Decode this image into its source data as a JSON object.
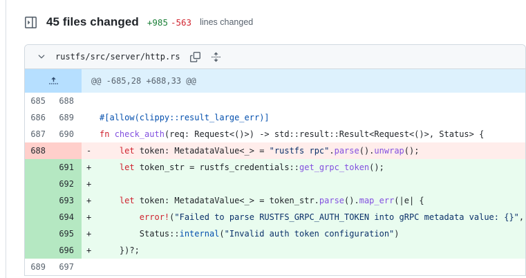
{
  "header": {
    "title": "45 files changed",
    "additions": "+985",
    "deletions": "-563",
    "suffix": "lines changed"
  },
  "file": {
    "path": "rustfs/src/server/http.rs",
    "hunk_header": "@@ -685,28 +688,33 @@"
  },
  "icons": {
    "sidebar_toggle": "sidebar-expand-icon",
    "collapse_chevron": "chevron-down-icon",
    "copy_path": "copy-icon",
    "unfold_file": "unfold-vertical-icon",
    "expand_hunk": "expand-up-icon"
  },
  "ui_colors": {
    "accent_green": "#1a7f37",
    "accent_red": "#d1242f",
    "border": "#d1d9e0",
    "file_header_bg": "#f6f8fa",
    "hunk_bg": "#ddf1fd",
    "hunk_gutter_bg": "#b6dfff",
    "hunk_text": "#59636e",
    "del_bg": "#ffedeb",
    "del_gutter_bg": "#ffcfcb",
    "add_bg": "#e9fcef",
    "add_gutter_bg": "#b5e8c2"
  },
  "syntax_colors": {
    "d": "#1f2328",
    "kw": "#cf222e",
    "fn": "#8250df",
    "call": "#0550ae",
    "attr": "#0550ae",
    "str": "#0a3069"
  },
  "diff": {
    "rows": [
      {
        "old": "685",
        "new": "688",
        "type": "context",
        "marker": " ",
        "code": []
      },
      {
        "old": "686",
        "new": "689",
        "type": "context",
        "marker": " ",
        "code": [
          {
            "t": "#[allow(clippy::result_large_err)]",
            "c": "attr"
          }
        ]
      },
      {
        "old": "687",
        "new": "690",
        "type": "context",
        "marker": " ",
        "code": [
          {
            "t": "fn",
            "c": "kw"
          },
          {
            "t": " ",
            "c": "d"
          },
          {
            "t": "check_auth",
            "c": "fn"
          },
          {
            "t": "(req: Request<()>) -> std::result::Result<Request<()>, Status> {",
            "c": "d"
          }
        ]
      },
      {
        "old": "688",
        "new": "",
        "type": "del",
        "marker": "-",
        "code": [
          {
            "t": "    ",
            "c": "d"
          },
          {
            "t": "let",
            "c": "kw"
          },
          {
            "t": " token: MetadataValue<_> = ",
            "c": "d"
          },
          {
            "t": "\"rustfs rpc\"",
            "c": "str"
          },
          {
            "t": ".",
            "c": "d"
          },
          {
            "t": "parse",
            "c": "fn"
          },
          {
            "t": "().",
            "c": "d"
          },
          {
            "t": "unwrap",
            "c": "fn"
          },
          {
            "t": "();",
            "c": "d"
          }
        ]
      },
      {
        "old": "",
        "new": "691",
        "type": "add",
        "marker": "+",
        "code": [
          {
            "t": "    ",
            "c": "d"
          },
          {
            "t": "let",
            "c": "kw"
          },
          {
            "t": " token_str = rustfs_credentials::",
            "c": "d"
          },
          {
            "t": "get_grpc_token",
            "c": "fn"
          },
          {
            "t": "();",
            "c": "d"
          }
        ]
      },
      {
        "old": "",
        "new": "692",
        "type": "add",
        "marker": "+",
        "code": []
      },
      {
        "old": "",
        "new": "693",
        "type": "add",
        "marker": "+",
        "code": [
          {
            "t": "    ",
            "c": "d"
          },
          {
            "t": "let",
            "c": "kw"
          },
          {
            "t": " token: MetadataValue<_> = token_str.",
            "c": "d"
          },
          {
            "t": "parse",
            "c": "fn"
          },
          {
            "t": "().",
            "c": "d"
          },
          {
            "t": "map_err",
            "c": "fn"
          },
          {
            "t": "(|e| {",
            "c": "d"
          }
        ]
      },
      {
        "old": "",
        "new": "694",
        "type": "add",
        "marker": "+",
        "code": [
          {
            "t": "        ",
            "c": "d"
          },
          {
            "t": "error!",
            "c": "kw"
          },
          {
            "t": "(",
            "c": "d"
          },
          {
            "t": "\"Failed to parse RUSTFS_GRPC_AUTH_TOKEN into gRPC metadata value: {}\"",
            "c": "str"
          },
          {
            "t": ", e);",
            "c": "d"
          }
        ]
      },
      {
        "old": "",
        "new": "695",
        "type": "add",
        "marker": "+",
        "code": [
          {
            "t": "        Status::",
            "c": "d"
          },
          {
            "t": "internal",
            "c": "call"
          },
          {
            "t": "(",
            "c": "d"
          },
          {
            "t": "\"Invalid auth token configuration\"",
            "c": "str"
          },
          {
            "t": ")",
            "c": "d"
          }
        ]
      },
      {
        "old": "",
        "new": "696",
        "type": "add",
        "marker": "+",
        "code": [
          {
            "t": "    })?;",
            "c": "d"
          }
        ]
      },
      {
        "old": "689",
        "new": "697",
        "type": "context",
        "marker": " ",
        "code": []
      }
    ]
  }
}
